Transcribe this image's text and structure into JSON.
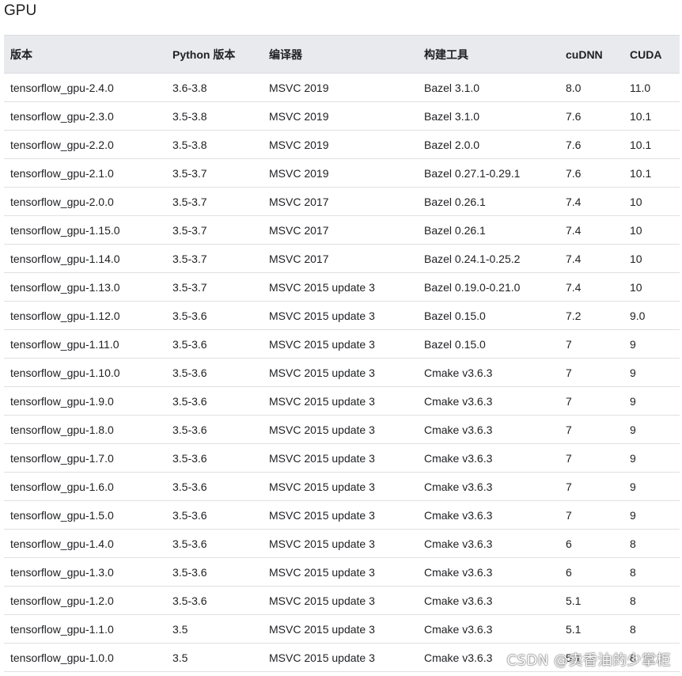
{
  "heading": "GPU",
  "table": {
    "headers": [
      "版本",
      "Python 版本",
      "编译器",
      "构建工具",
      "cuDNN",
      "CUDA"
    ],
    "rows": [
      [
        "tensorflow_gpu-2.4.0",
        "3.6-3.8",
        "MSVC 2019",
        "Bazel 3.1.0",
        "8.0",
        "11.0"
      ],
      [
        "tensorflow_gpu-2.3.0",
        "3.5-3.8",
        "MSVC 2019",
        "Bazel 3.1.0",
        "7.6",
        "10.1"
      ],
      [
        "tensorflow_gpu-2.2.0",
        "3.5-3.8",
        "MSVC 2019",
        "Bazel 2.0.0",
        "7.6",
        "10.1"
      ],
      [
        "tensorflow_gpu-2.1.0",
        "3.5-3.7",
        "MSVC 2019",
        "Bazel 0.27.1-0.29.1",
        "7.6",
        "10.1"
      ],
      [
        "tensorflow_gpu-2.0.0",
        "3.5-3.7",
        "MSVC 2017",
        "Bazel 0.26.1",
        "7.4",
        "10"
      ],
      [
        "tensorflow_gpu-1.15.0",
        "3.5-3.7",
        "MSVC 2017",
        "Bazel 0.26.1",
        "7.4",
        "10"
      ],
      [
        "tensorflow_gpu-1.14.0",
        "3.5-3.7",
        "MSVC 2017",
        "Bazel 0.24.1-0.25.2",
        "7.4",
        "10"
      ],
      [
        "tensorflow_gpu-1.13.0",
        "3.5-3.7",
        "MSVC 2015 update 3",
        "Bazel 0.19.0-0.21.0",
        "7.4",
        "10"
      ],
      [
        "tensorflow_gpu-1.12.0",
        "3.5-3.6",
        "MSVC 2015 update 3",
        "Bazel 0.15.0",
        "7.2",
        "9.0"
      ],
      [
        "tensorflow_gpu-1.11.0",
        "3.5-3.6",
        "MSVC 2015 update 3",
        "Bazel 0.15.0",
        "7",
        "9"
      ],
      [
        "tensorflow_gpu-1.10.0",
        "3.5-3.6",
        "MSVC 2015 update 3",
        "Cmake v3.6.3",
        "7",
        "9"
      ],
      [
        "tensorflow_gpu-1.9.0",
        "3.5-3.6",
        "MSVC 2015 update 3",
        "Cmake v3.6.3",
        "7",
        "9"
      ],
      [
        "tensorflow_gpu-1.8.0",
        "3.5-3.6",
        "MSVC 2015 update 3",
        "Cmake v3.6.3",
        "7",
        "9"
      ],
      [
        "tensorflow_gpu-1.7.0",
        "3.5-3.6",
        "MSVC 2015 update 3",
        "Cmake v3.6.3",
        "7",
        "9"
      ],
      [
        "tensorflow_gpu-1.6.0",
        "3.5-3.6",
        "MSVC 2015 update 3",
        "Cmake v3.6.3",
        "7",
        "9"
      ],
      [
        "tensorflow_gpu-1.5.0",
        "3.5-3.6",
        "MSVC 2015 update 3",
        "Cmake v3.6.3",
        "7",
        "9"
      ],
      [
        "tensorflow_gpu-1.4.0",
        "3.5-3.6",
        "MSVC 2015 update 3",
        "Cmake v3.6.3",
        "6",
        "8"
      ],
      [
        "tensorflow_gpu-1.3.0",
        "3.5-3.6",
        "MSVC 2015 update 3",
        "Cmake v3.6.3",
        "6",
        "8"
      ],
      [
        "tensorflow_gpu-1.2.0",
        "3.5-3.6",
        "MSVC 2015 update 3",
        "Cmake v3.6.3",
        "5.1",
        "8"
      ],
      [
        "tensorflow_gpu-1.1.0",
        "3.5",
        "MSVC 2015 update 3",
        "Cmake v3.6.3",
        "5.1",
        "8"
      ],
      [
        "tensorflow_gpu-1.0.0",
        "3.5",
        "MSVC 2015 update 3",
        "Cmake v3.6.3",
        "5.1",
        "8"
      ]
    ]
  },
  "watermark": "CSDN @卖香油的少掌柜"
}
